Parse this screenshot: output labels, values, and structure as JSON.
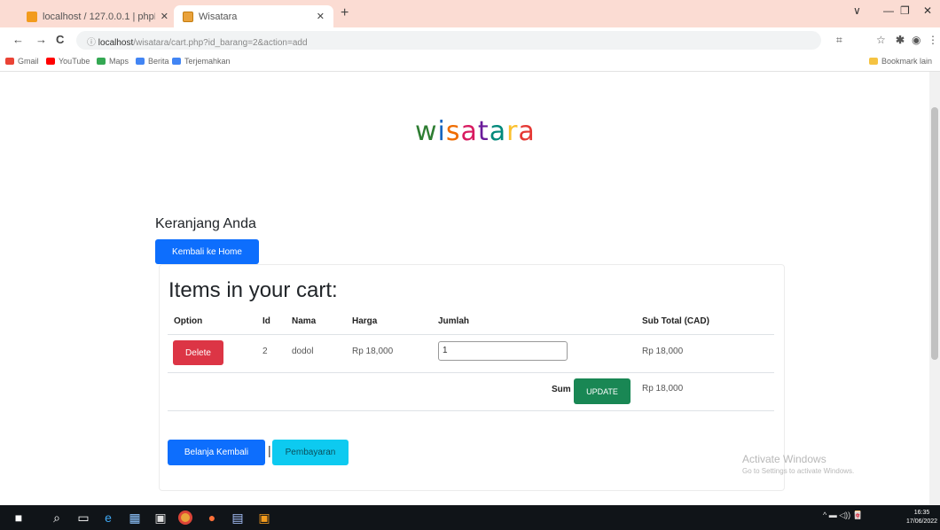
{
  "browser": {
    "tabs": [
      {
        "title": "localhost / 127.0.0.1 | phpMyAdmin",
        "icon": "phpmyadmin-icon"
      },
      {
        "title": "Wisatara",
        "icon": "page-favicon-icon"
      }
    ],
    "new_tab_symbol": "+",
    "close_symbol": "✕",
    "window_controls": {
      "collapse": "∨",
      "minimize": "—",
      "maximize": "❐",
      "close": "✕"
    },
    "nav": {
      "back": "←",
      "forward": "→",
      "reload": "C"
    },
    "url_host": "localhost",
    "url_path": "/wisatara/cart.php?id_barang=2&action=add",
    "bookmarks": [
      {
        "label": "Gmail",
        "color": "#ea4335"
      },
      {
        "label": "YouTube",
        "color": "#ff0000"
      },
      {
        "label": "Maps",
        "color": "#34a853"
      },
      {
        "label": "Berita",
        "color": "#4285f4"
      },
      {
        "label": "Terjemahkan",
        "color": "#4285f4"
      }
    ],
    "other_bookmarks": "Bookmark lain"
  },
  "site": {
    "logo_letters": [
      "w",
      "i",
      "s",
      "a",
      "t",
      "a",
      "r",
      "a"
    ],
    "logo_colors": [
      "#2e7d32",
      "#1565c0",
      "#ef6c00",
      "#d81b60",
      "#6a1b9a",
      "#00897b",
      "#fbc02d",
      "#e53935"
    ]
  },
  "cart": {
    "heading": "Keranjang Anda",
    "home_button": "Kembali ke Home",
    "title": "Items in your cart:",
    "columns": [
      "Option",
      "Id",
      "Nama",
      "Harga",
      "Jumlah",
      "Sub Total (CAD)"
    ],
    "rows": [
      {
        "delete_label": "Delete",
        "id": "2",
        "nama": "dodol",
        "harga": "Rp 18,000",
        "jumlah": "1",
        "subtotal": "Rp 18,000"
      }
    ],
    "sum_label": "Sum",
    "update_label": "UPDATE",
    "sum_value": "Rp 18,000",
    "belanja_button": "Belanja Kembali",
    "separator": "|",
    "bayar_button": "Pembayaran"
  },
  "watermark": {
    "line1": "Activate Windows",
    "line2": "Go to Settings to activate Windows."
  },
  "taskbar": {
    "time": "16:35",
    "date": "17/06/2022",
    "tray": "^ ▬ ◁)) 🀄"
  },
  "colors": {
    "tab_bar": "#fbdcd3",
    "primary": "#0d6efd",
    "danger": "#dc3545",
    "success": "#198754",
    "info": "#0dcaf0"
  }
}
